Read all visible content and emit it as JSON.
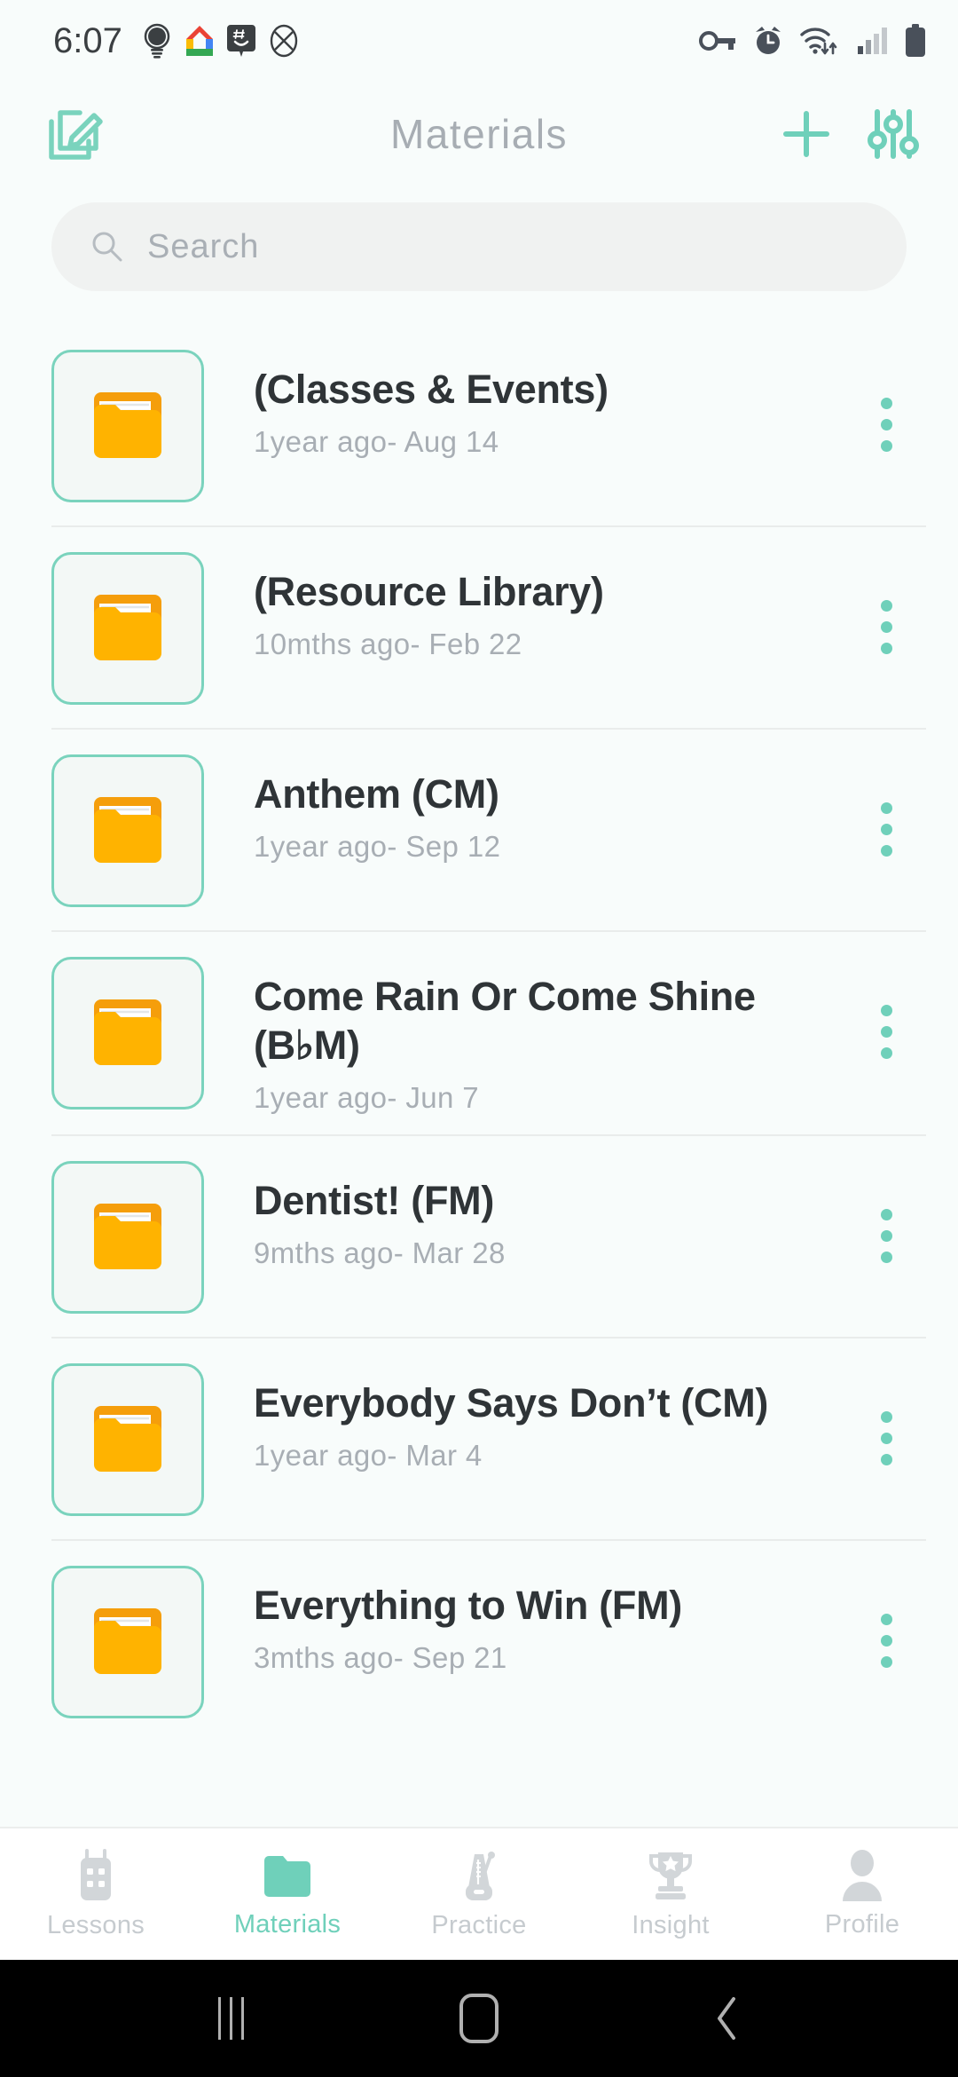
{
  "status_bar": {
    "time": "6:07",
    "notification_icons": [
      "lightbulb-icon",
      "google-home-icon",
      "chat-hashtag-icon",
      "crossed-circle-icon"
    ],
    "system_icons": [
      "vpn-key-icon",
      "alarm-icon",
      "wifi-icon",
      "cellular-signal-icon",
      "battery-icon"
    ]
  },
  "header": {
    "title": "Materials",
    "edit_icon": "compose-edit-icon",
    "add_icon": "plus-icon",
    "filter_icon": "sliders-filter-icon"
  },
  "search": {
    "placeholder": "Search",
    "value": "",
    "icon": "search-icon"
  },
  "list": {
    "items": [
      {
        "title": "(Classes & Events)",
        "subtitle": "1year ago- Aug 14",
        "icon": "folder-icon",
        "menu": "more-vertical-icon"
      },
      {
        "title": "(Resource Library)",
        "subtitle": "10mths ago- Feb 22",
        "icon": "folder-icon",
        "menu": "more-vertical-icon"
      },
      {
        "title": "Anthem (CM)",
        "subtitle": "1year ago- Sep 12",
        "icon": "folder-icon",
        "menu": "more-vertical-icon"
      },
      {
        "title": "Come Rain Or Come Shine (B♭M)",
        "subtitle": "1year ago- Jun 7",
        "icon": "folder-icon",
        "menu": "more-vertical-icon"
      },
      {
        "title": "Dentist! (FM)",
        "subtitle": "9mths ago- Mar 28",
        "icon": "folder-icon",
        "menu": "more-vertical-icon"
      },
      {
        "title": "Everybody Says Don’t (CM)",
        "subtitle": "1year ago- Mar 4",
        "icon": "folder-icon",
        "menu": "more-vertical-icon"
      },
      {
        "title": "Everything to Win (FM)",
        "subtitle": "3mths ago- Sep 21",
        "icon": "folder-icon",
        "menu": "more-vertical-icon"
      }
    ]
  },
  "bottom_nav": {
    "items": [
      {
        "label": "Lessons",
        "icon": "calendar-icon",
        "active": false
      },
      {
        "label": "Materials",
        "icon": "folder-icon",
        "active": true
      },
      {
        "label": "Practice",
        "icon": "metronome-icon",
        "active": false
      },
      {
        "label": "Insight",
        "icon": "trophy-icon",
        "active": false
      },
      {
        "label": "Profile",
        "icon": "person-icon",
        "active": false
      }
    ]
  },
  "android_nav": {
    "recents": "recents-icon",
    "home": "home-icon",
    "back": "back-icon"
  },
  "colors": {
    "accent_teal": "#6FD0BA",
    "folder_orange": "#FFB300",
    "folder_orange_dark": "#F59E0B",
    "title_gray": "#A7ADB3",
    "text_dark": "#2F3437",
    "subtext_gray": "#A8AEB4",
    "background": "#F8FCFB"
  }
}
